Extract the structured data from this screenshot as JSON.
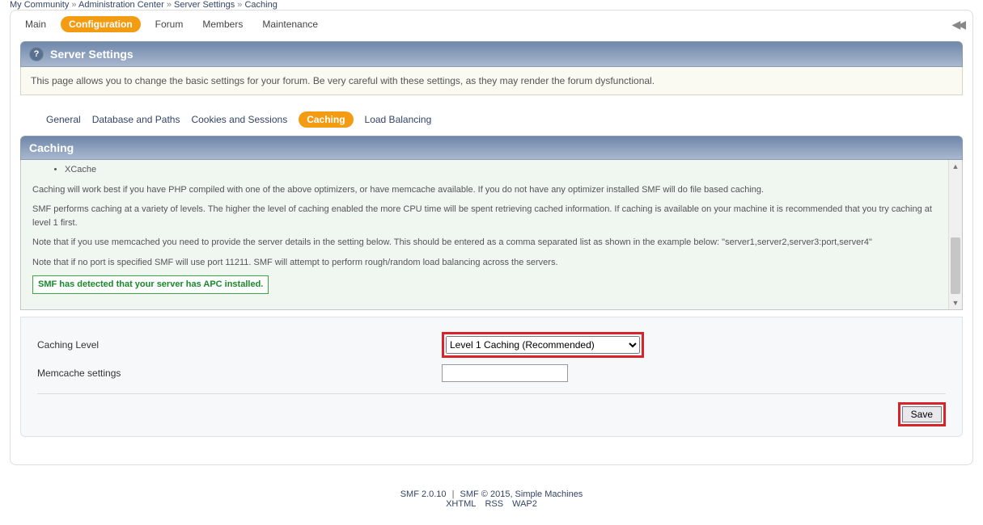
{
  "breadcrumb": {
    "items": [
      "My Community",
      "Administration Center",
      "Server Settings",
      "Caching"
    ],
    "sep": "»"
  },
  "topmenu": {
    "main": "Main",
    "configuration": "Configuration",
    "forum": "Forum",
    "members": "Members",
    "maintenance": "Maintenance"
  },
  "panel1": {
    "title": "Server Settings",
    "desc": "This page allows you to change the basic settings for your forum. Be very careful with these settings, as they may render the forum dysfunctional."
  },
  "subnav": {
    "general": "General",
    "db": "Database and Paths",
    "cookies": "Cookies and Sessions",
    "caching": "Caching",
    "lb": "Load Balancing"
  },
  "panel2": {
    "title": "Caching"
  },
  "scroll": {
    "bullet1": "XCache",
    "p1": "Caching will work best if you have PHP compiled with one of the above optimizers, or have memcache available. If you do not have any optimizer installed SMF will do file based caching.",
    "p2": "SMF performs caching at a variety of levels. The higher the level of caching enabled the more CPU time will be spent retrieving cached information. If caching is available on your machine it is recommended that you try caching at level 1 first.",
    "p3": "Note that if you use memcached you need to provide the server details in the setting below. This should be entered as a comma separated list as shown in the example below: \"server1,server2,server3:port,server4\"",
    "p4": "Note that if no port is specified SMF will use port 11211. SMF will attempt to perform rough/random load balancing across the servers.",
    "apc": "SMF has detected that your server has APC installed."
  },
  "form": {
    "label_level": "Caching Level",
    "label_mem": "Memcache settings",
    "select_value": "Level 1 Caching (Recommended)",
    "mem_value": "",
    "save": "Save"
  },
  "footer": {
    "line1a": "SMF 2.0.10",
    "line1b": "SMF © 2015, Simple Machines",
    "sep": " | ",
    "xhtml": "XHTML",
    "rss": "RSS",
    "wap2": "WAP2"
  }
}
